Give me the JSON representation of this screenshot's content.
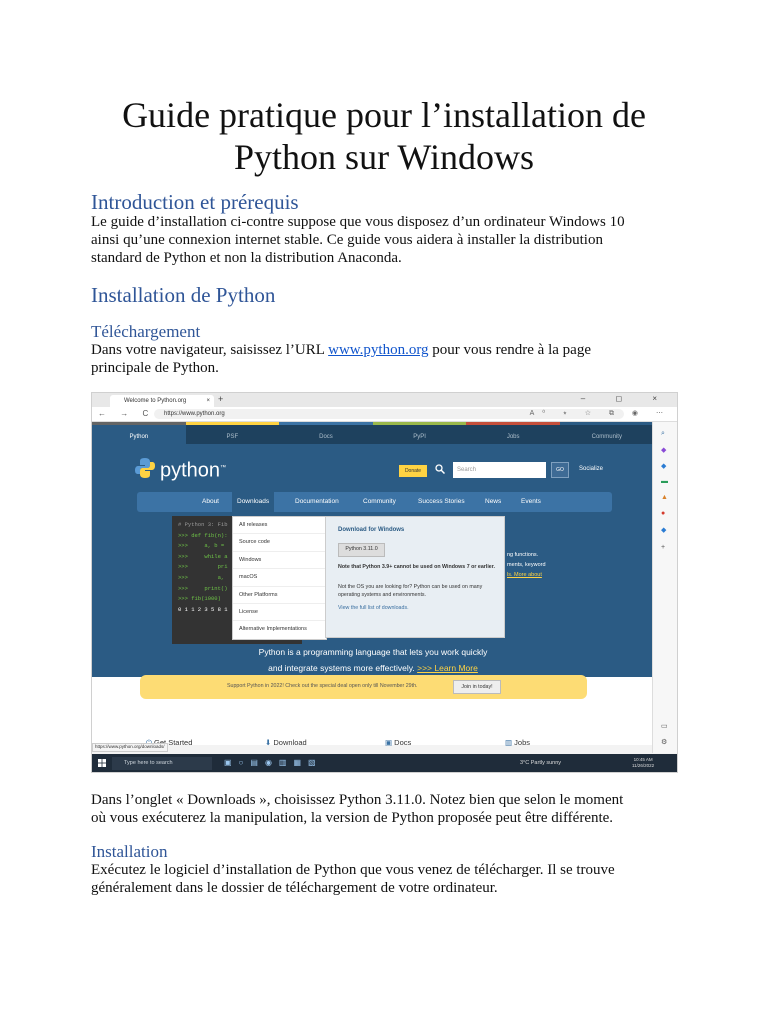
{
  "document": {
    "title_line1": "Guide pratique pour l’installation de",
    "title_line2": "Python sur Windows",
    "intro_heading": "Introduction et prérequis",
    "intro_line1": "Le guide d’installation ci-contre suppose que vous disposez d’un ordinateur Windows 10",
    "intro_line2": "ainsi qu’une connexion internet stable. Ce guide vous aidera à installer la distribution",
    "intro_line3": "standard de Python et non la distribution Anaconda.",
    "install_heading": "Installation de Python",
    "download_subheading": "Téléchargement",
    "download_line1_a": "Dans votre navigateur, saisissez l’URL ",
    "download_link": "www.python.org",
    "download_line1_b": " pour vous rendre à la page",
    "download_line2": "principale de Python.",
    "after_line1": "Dans l’onglet « Downloads », choisissez Python 3.11.0. Notez bien que selon le moment",
    "after_line2": "où vous exécuterez la manipulation, la version de Python proposée peut être différente.",
    "installation_subheading": "Installation",
    "installation_line1": "Exécutez le logiciel d’installation de Python que vous venez de télécharger. Il se trouve",
    "installation_line2": "généralement dans le dossier de téléchargement de votre ordinateur."
  },
  "screenshot": {
    "tab_title": "Welcome to Python.org",
    "tab_close": "×",
    "new_tab": "+",
    "window_controls": "–  ◻  ×",
    "nav_buttons": "←  →  C  ⌂",
    "url": "https://www.python.org",
    "browser_icons": "A⁰ ⭒ ☆ ⧉ ◉ ⋯",
    "top_nav": [
      "Python",
      "PSF",
      "Docs",
      "PyPI",
      "Jobs",
      "Community"
    ],
    "top_nav_colors": [
      "#646565",
      "#ffd343",
      "#3c73a5",
      "#9ab84b",
      "#c44f3b",
      "#2b5b84"
    ],
    "logo_text": "python",
    "logo_tm": "™",
    "donate": "Donate",
    "search_placeholder": "Search",
    "go": "GO",
    "socialize": "Socialize",
    "main_menu": [
      "About",
      "Downloads",
      "Documentation",
      "Community",
      "Success Stories",
      "News",
      "Events"
    ],
    "code_lines": [
      "# Python 3: Fib",
      ">>> def fib(n):",
      ">>>     a, b =",
      ">>>     while a",
      ">>>         pri",
      ">>>         a,",
      ">>>     print()",
      ">>> fib(1000)",
      "0 1 1 2 3 5 8 1"
    ],
    "dropdown": [
      "All releases",
      "Source code",
      "Windows",
      "macOS",
      "Other Platforms",
      "License",
      "Alternative Implementations"
    ],
    "dl_title": "Download for Windows",
    "dl_button": "Python 3.11.0",
    "dl_note": "Note that Python 3.9+ cannot be used on Windows 7 or earlier.",
    "dl_desc": "Not the OS you are looking for? Python can be used on many operating systems and environments.",
    "dl_view": "View the full list of downloads.",
    "right_copy1": "ng functions.",
    "right_copy2": "ments, keyword",
    "right_copy_link": "ls. More about",
    "tagline1": "Python is a programming language that lets you work quickly",
    "tagline2_a": "and integrate systems more effectively. ",
    "tagline2_link": ">>> Learn More",
    "banner_text": "Support Python in 2022! Check out the special deal open only till November 29th.",
    "banner_button": "Join in today!",
    "widgets": [
      "Get Started",
      "Download",
      "Docs",
      "Jobs"
    ],
    "status_url": "https://www.python.org/downloads/",
    "taskbar_search": "Type here to search",
    "weather": "3°C  Partly sunny",
    "clock_time": "10:45 AM",
    "clock_date": "11/26/2022"
  }
}
